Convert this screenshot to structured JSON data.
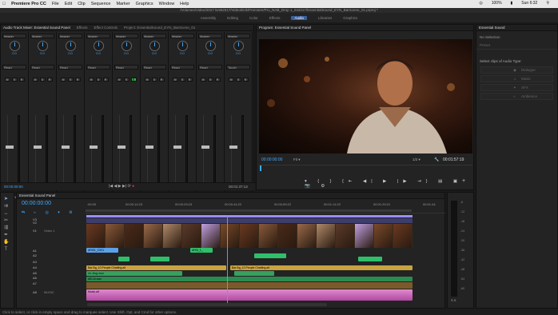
{
  "menubar": {
    "apple": "",
    "app": "Premiere Pro CC",
    "items": [
      "File",
      "Edit",
      "Clip",
      "Sequence",
      "Marker",
      "Graphics",
      "Window",
      "Help"
    ],
    "status": {
      "battery": "100%",
      "clock": "Sun 6:32"
    }
  },
  "path": "/Volumes/Video/2017 NAB2017/Video/Erik/Premiere/Pro_NAB_Drop 1_032017/EssentialSound_EYN_BarScene_01.prproj *",
  "workspaces": [
    "Assembly",
    "Editing",
    "Color",
    "Effects",
    "Audio",
    "Libraries",
    "Graphics"
  ],
  "workspace_active": "Audio",
  "mixer": {
    "tabs": [
      "Audio Track Mixer: Essential Sound Panel",
      "Effects",
      "Effect Controls",
      "Project: EssentialSound_EYN_BarScene_01"
    ],
    "strips": [
      {
        "sel": "Master",
        "mode": "Read",
        "value": "1.2",
        "label": "BARTEND"
      },
      {
        "sel": "Master",
        "mode": "Read",
        "value": "0.0",
        "label": "CUY1"
      },
      {
        "sel": "Master",
        "mode": "Read",
        "value": "0.0",
        "label": "CUY2"
      },
      {
        "sel": "Master",
        "mode": "Read",
        "value": "0.0",
        "label": "BARTEND"
      },
      {
        "sel": "Master",
        "mode": "Read",
        "value": "0.0",
        "label": "AMB_BAR"
      },
      {
        "sel": "Master",
        "mode": "Read",
        "value": "0.0",
        "label": "DIACOMP"
      },
      {
        "sel": "Master",
        "mode": "Read",
        "value": "0.0",
        "label": "AMB_2"
      },
      {
        "sel": "Master",
        "mode": "Read",
        "value": "0.0",
        "label": "MUS"
      },
      {
        "sel": "Master",
        "mode": "Touch",
        "value": "0.0",
        "label": "MUS"
      }
    ],
    "timecode_left": "00:00:00:00",
    "timecode_right": "00:01:37:13"
  },
  "program": {
    "title": "Program: Essential Sound Panel",
    "timecode": "00:00:00:00",
    "fit": "Fit",
    "quality": "1/2",
    "duration": "00:01:57:19"
  },
  "essential": {
    "title": "Essential Sound",
    "no_selection": "No Selection",
    "preset": "Preset",
    "prompt": "Select clips of Audio Type:",
    "types": [
      "Dialogue",
      "Music",
      "SFX",
      "Ambience"
    ]
  },
  "timeline": {
    "tab": "Essential Sound Panel",
    "timecode": "00:00:00:00",
    "ruler": [
      ":00:00",
      "00:00:14:23",
      "00:00:29:23",
      "00:00:44:22",
      "00:00:59:22",
      "00:01:14:22",
      "00:01:29:21",
      "00:01:44"
    ],
    "tracks": [
      "V3",
      "V2",
      "V1",
      "A1",
      "A2",
      "A3",
      "A4",
      "A5",
      "A6",
      "A7",
      "A8"
    ],
    "track_names": {
      "v1": "Video 1",
      "a8": "MUSIC"
    },
    "clip_labels": {
      "v1": "ARI01_C001",
      "a1": "ARI0_1_",
      "a3_1": "Bar Bg_10 People Chatting.aif",
      "a3_2": "Bar Bg_10 People Chatting.aif",
      "a4": "UL-Dog mon",
      "a5": "AB-16.wav",
      "a7": "Music.aif"
    }
  },
  "meter_scale": [
    "-6",
    "-12",
    "-18",
    "-24",
    "-30",
    "-36",
    "-42",
    "-48",
    "-54",
    "-60"
  ],
  "statusbar": "Click to select, or click in empty space and drag to marquee select. Use Shift, Opt, and Cmd for other options.",
  "colors": {
    "accent": "#3fa9ff",
    "video_clip": "#5ca1e8",
    "audio_clip": "#2fbf6b",
    "bg_clip": "#c8a340",
    "music_clip": "#d874c4"
  }
}
